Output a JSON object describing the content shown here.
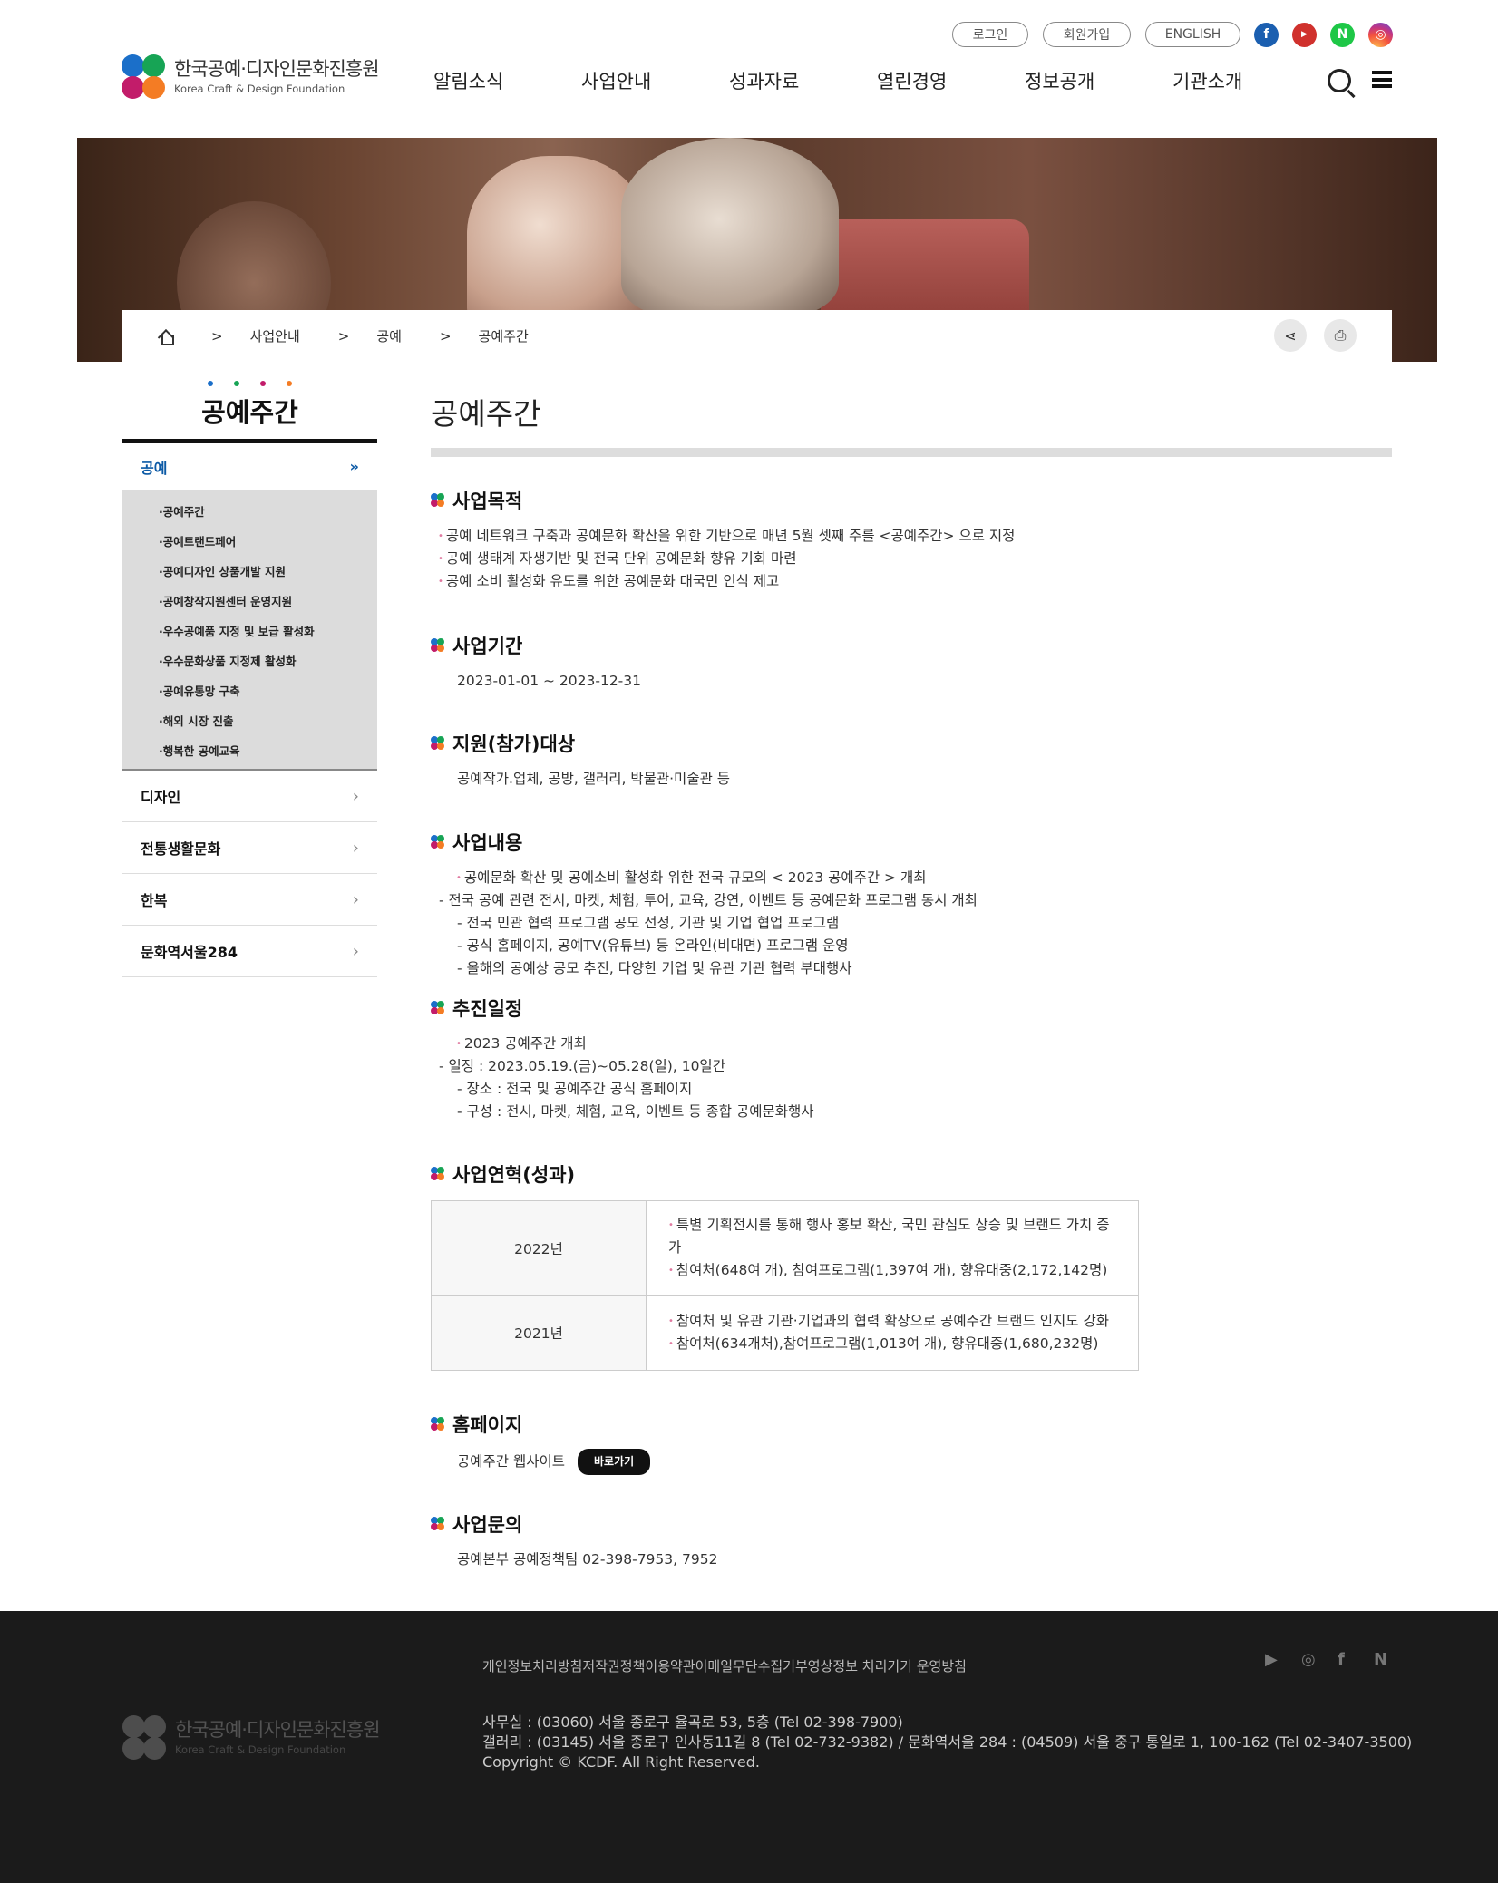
{
  "header": {
    "logo_ko": "한국공예·디자인문화진흥원",
    "logo_en": "Korea Craft & Design Foundation",
    "utils": [
      "로그인",
      "회원가입",
      "ENGLISH"
    ],
    "nav": [
      "알림소식",
      "사업안내",
      "성과자료",
      "열린경영",
      "정보공개",
      "기관소개"
    ]
  },
  "breadcrumb": [
    "사업안내",
    "공예",
    "공예주간"
  ],
  "sidebar": {
    "title": "공예주간",
    "selected": "공예",
    "sub": [
      "·공예주간",
      "·공예트랜드페어",
      "·공예디자인 상품개발 지원",
      "·공예창작지원센터 운영지원",
      "·우수공예품 지정 및 보급 활성화",
      "·우수문화상품 지정제 활성화",
      "·공예유통망 구축",
      "·해외 시장 진출",
      "·행복한 공예교육"
    ],
    "items": [
      "디자인",
      "전통생활문화",
      "한복",
      "문화역서울284"
    ]
  },
  "main": {
    "title": "공예주간",
    "s1": {
      "h": "사업목적",
      "lines": [
        "공예 네트워크 구축과 공예문화 확산을 위한 기반으로 매년 5월 셋째 주를 <공예주간> 으로 지정",
        "공예 생태계 자생기반 및 전국 단위 공예문화 향유 기회 마련",
        "공예 소비 활성화 유도를 위한 공예문화 대국민 인식 제고"
      ]
    },
    "s2": {
      "h": "사업기간",
      "text": "2023-01-01 ~ 2023-12-31"
    },
    "s3": {
      "h": "지원(참가)대상",
      "text": "공예작가.업체, 공방, 갤러리, 박물관·미술관 등"
    },
    "s4": {
      "h": "사업내용",
      "l1": "공예문화 확산 및 공예소비 활성화 위한 전국 규모의 < 2023 공예주간 > 개최",
      "l2": "- 전국 공예 관련 전시, 마켓, 체험, 투어, 교육, 강연, 이벤트 등 공예문화 프로그램 동시 개최",
      "l3": "- 전국 민관 협력 프로그램 공모 선정, 기관 및 기업 협업 프로그램",
      "l4": "- 공식 홈페이지, 공예TV(유튜브) 등 온라인(비대면) 프로그램 운영",
      "l5": "- 올해의 공예상 공모 추진, 다양한 기업 및 유관 기관 협력 부대행사"
    },
    "s5": {
      "h": "추진일정",
      "l1": "2023 공예주간 개최",
      "l2": "- 일정 : 2023.05.19.(금)~05.28(일), 10일간",
      "l3": "- 장소 : 전국 및 공예주간 공식 홈페이지",
      "l4": "- 구성 : 전시, 마켓, 체험, 교육, 이벤트 등 종합 공예문화행사"
    },
    "s6": {
      "h": "사업연혁(성과)",
      "rows": [
        {
          "year": "2022년",
          "a": "특별 기획전시를 통해 행사 홍보 확산, 국민 관심도 상승 및 브랜드 가치 증가",
          "b": "참여처(648여 개), 참여프로그램(1,397여 개), 향유대중(2,172,142명)"
        },
        {
          "year": "2021년",
          "a": "참여처 및 유관 기관·기업과의 협력 확장으로 공예주간 브랜드 인지도 강화",
          "b": "참여처(634개처),참여프로그램(1,013여 개), 향유대중(1,680,232명)"
        }
      ]
    },
    "s7": {
      "h": "홈페이지",
      "text": "공예주간 웹사이트",
      "btn": "바로가기"
    },
    "s8": {
      "h": "사업문의",
      "text": "공예본부 공예정책팀 02-398-7953, 7952"
    }
  },
  "footer": {
    "links": "개인정보처리방침저작권정책이용약관이메일무단수집거부영상정보 처리기기 운영방침",
    "logo_ko": "한국공예·디자인문화진흥원",
    "logo_en": "Korea Craft & Design Foundation",
    "addr1": "사무실 : (03060) 서울 종로구 율곡로 53, 5층 (Tel 02-398-7900)",
    "addr2": "갤러리 : (03145) 서울 종로구 인사동11길 8 (Tel 02-732-9382) / 문화역서울 284 : (04509) 서울 중구 통일로 1, 100-162 (Tel 02-3407-3500)",
    "copy": "Copyright © KCDF. All Right Reserved."
  },
  "colors": {
    "accent": "#0c5aa6",
    "footer_bg": "#1b1b1b"
  },
  "icons": [
    "home-icon",
    "share-icon",
    "print-icon",
    "search-icon",
    "menu-icon",
    "facebook-icon",
    "youtube-icon",
    "naver-icon",
    "instagram-icon"
  ]
}
